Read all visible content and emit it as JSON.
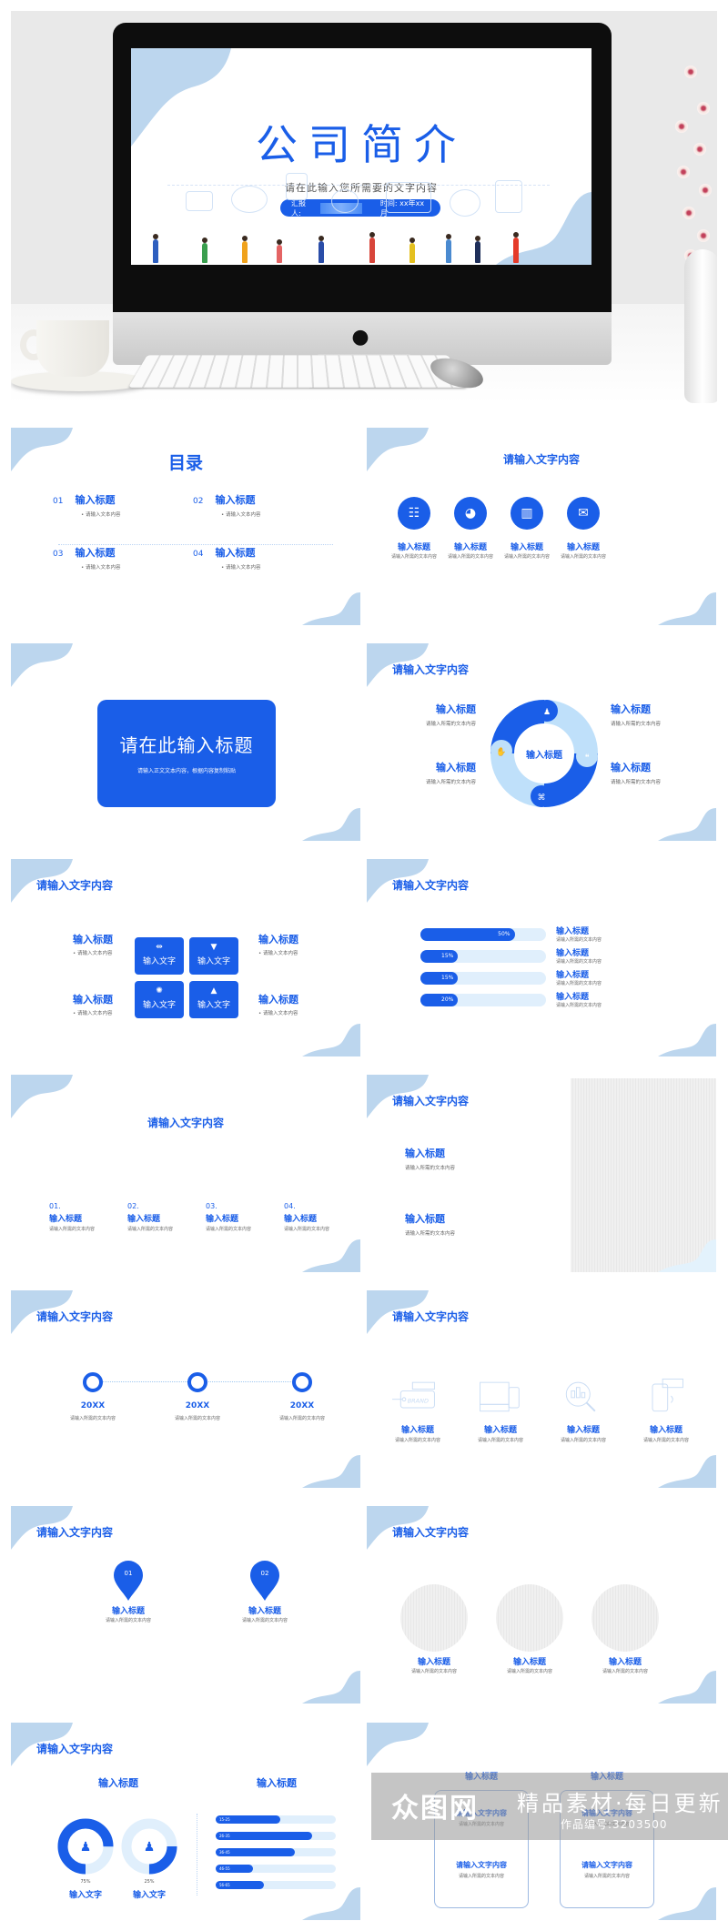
{
  "hero": {
    "screen_title": "公司简介",
    "screen_subtitle": "请在此输入您所需要的文字内容",
    "reporter_label": "汇报人:",
    "time_label": "时间: xx年xx月",
    "apple_glyph": "apple-logo"
  },
  "colors": {
    "primary": "#1a5ee8",
    "light": "#bcd6ee",
    "track": "#e0effc",
    "text_muted": "#666666"
  },
  "slides": {
    "toc": {
      "title": "目录",
      "items": [
        {
          "num": "01",
          "title": "输入标题",
          "desc": "• 请输入文本内容"
        },
        {
          "num": "02",
          "title": "输入标题",
          "desc": "• 请输入文本内容"
        },
        {
          "num": "03",
          "title": "输入标题",
          "desc": "• 请输入文本内容"
        },
        {
          "num": "04",
          "title": "输入标题",
          "desc": "• 请输入文本内容"
        }
      ]
    },
    "icons4": {
      "title": "请输入文字内容",
      "items": [
        {
          "icon": "clipboard-icon",
          "glyph": "☷",
          "title": "输入标题",
          "desc": "请输入所需的文本内容"
        },
        {
          "icon": "pie-chart-icon",
          "glyph": "◕",
          "title": "输入标题",
          "desc": "请输入所需的文本内容"
        },
        {
          "icon": "bar-chart-icon",
          "glyph": "▥",
          "title": "输入标题",
          "desc": "请输入所需的文本内容"
        },
        {
          "icon": "chat-icon",
          "glyph": "✉",
          "title": "输入标题",
          "desc": "请输入所需的文本内容"
        }
      ]
    },
    "section": {
      "title": "请在此输入标题",
      "desc": "请输入正文文本内容，根据内容复制粘贴"
    },
    "ring": {
      "title": "请输入文字内容",
      "center": "输入标题",
      "items": [
        {
          "title": "输入标题",
          "desc": "请输入所需的文本内容"
        },
        {
          "title": "输入标题",
          "desc": "请输入所需的文本内容"
        },
        {
          "title": "输入标题",
          "desc": "请输入所需的文本内容"
        },
        {
          "title": "输入标题",
          "desc": "请输入所需的文本内容"
        }
      ],
      "icons": [
        "team-icon",
        "chat-bubbles-icon",
        "network-icon",
        "handshake-icon"
      ]
    },
    "grid": {
      "title": "请输入文字内容",
      "squares": [
        {
          "icon": "dumbbell-icon",
          "glyph": "⇹",
          "label": "输入文字"
        },
        {
          "icon": "thumbs-down-icon",
          "glyph": "▼",
          "label": "输入文字"
        },
        {
          "icon": "lightbulb-icon",
          "glyph": "✺",
          "label": "输入文字"
        },
        {
          "icon": "warning-icon",
          "glyph": "▲",
          "label": "输入文字"
        }
      ],
      "items": [
        {
          "title": "输入标题",
          "desc": "• 请输入文本内容"
        },
        {
          "title": "输入标题",
          "desc": "• 请输入文本内容"
        },
        {
          "title": "输入标题",
          "desc": "• 请输入文本内容"
        },
        {
          "title": "输入标题",
          "desc": "• 请输入文本内容"
        }
      ]
    },
    "progress": {
      "title": "请输入文字内容",
      "items": [
        {
          "value": 50,
          "label": "50%",
          "title": "输入标题",
          "desc": "请输入所需的文本内容"
        },
        {
          "value": 15,
          "label": "15%",
          "title": "输入标题",
          "desc": "请输入所需的文本内容"
        },
        {
          "value": 15,
          "label": "15%",
          "title": "输入标题",
          "desc": "请输入所需的文本内容"
        },
        {
          "value": 20,
          "label": "20%",
          "title": "输入标题",
          "desc": "请输入所需的文本内容"
        }
      ]
    },
    "steps": {
      "title": "请输入文字内容",
      "items": [
        {
          "num": "01.",
          "title": "输入标题",
          "desc": "请输入所需的文本内容"
        },
        {
          "num": "02.",
          "title": "输入标题",
          "desc": "请输入所需的文本内容"
        },
        {
          "num": "03.",
          "title": "输入标题",
          "desc": "请输入所需的文本内容"
        },
        {
          "num": "04.",
          "title": "输入标题",
          "desc": "请输入所需的文本内容"
        }
      ]
    },
    "image_text": {
      "title": "请输入文字内容",
      "items": [
        {
          "title": "输入标题",
          "desc": "请输入所需的文本内容"
        },
        {
          "title": "输入标题",
          "desc": "请输入所需的文本内容"
        }
      ]
    },
    "timeline": {
      "title": "请输入文字内容",
      "items": [
        {
          "year": "20XX",
          "desc": "请输入所需的文本内容"
        },
        {
          "year": "20XX",
          "desc": "请输入所需的文本内容"
        },
        {
          "year": "20XX",
          "desc": "请输入所需的文本内容"
        }
      ]
    },
    "line_icons": {
      "title": "请输入文字内容",
      "items": [
        {
          "icon": "brand-tag-icon",
          "tag": "BRAND",
          "title": "输入标题",
          "desc": "请输入所需的文本内容"
        },
        {
          "icon": "devices-icon",
          "title": "输入标题",
          "desc": "请输入所需的文本内容"
        },
        {
          "icon": "analytics-search-icon",
          "title": "输入标题",
          "desc": "请输入所需的文本内容"
        },
        {
          "icon": "mobile-app-icon",
          "title": "输入标题",
          "desc": "请输入所需的文本内容"
        }
      ]
    },
    "pins": {
      "title": "请输入文字内容",
      "items": [
        {
          "num": "01",
          "title": "输入标题",
          "desc": "请输入所需的文本内容"
        },
        {
          "num": "02",
          "title": "输入标题",
          "desc": "请输入所需的文本内容"
        }
      ]
    },
    "circles": {
      "title": "请输入文字内容",
      "items": [
        {
          "title": "输入标题",
          "desc": "请输入所需的文本内容"
        },
        {
          "title": "输入标题",
          "desc": "请输入所需的文本内容"
        },
        {
          "title": "输入标题",
          "desc": "请输入所需的文本内容"
        }
      ]
    },
    "stats": {
      "title": "请输入文字内容",
      "left_title": "输入标题",
      "right_title": "输入标题",
      "donuts": [
        {
          "icon": "female-icon",
          "value": 75,
          "label": "75%",
          "caption": "输入文字"
        },
        {
          "icon": "male-icon",
          "value": 25,
          "label": "25%",
          "caption": "输入文字"
        }
      ],
      "age_bars": [
        {
          "label": "15-25",
          "value": 54
        },
        {
          "label": "26-35",
          "value": 80
        },
        {
          "label": "36-45",
          "value": 66
        },
        {
          "label": "46-55",
          "value": 31
        },
        {
          "label": "56-65",
          "value": 40
        }
      ]
    },
    "boxes": {
      "items": [
        {
          "head": "输入标题",
          "t1": "请输入文字内容",
          "d1": "请输入所需的文本内容",
          "t2": "请输入文字内容",
          "d2": "请输入所需的文本内容"
        },
        {
          "head": "输入标题",
          "t1": "请输入文字内容",
          "d1": "请输入所需的文本内容",
          "t2": "请输入文字内容",
          "d2": "请输入所需的文本内容"
        }
      ]
    }
  },
  "watermark": {
    "logo": "众图网",
    "main": "精品素材·每日更新",
    "sub": "作品编号:3203500"
  }
}
